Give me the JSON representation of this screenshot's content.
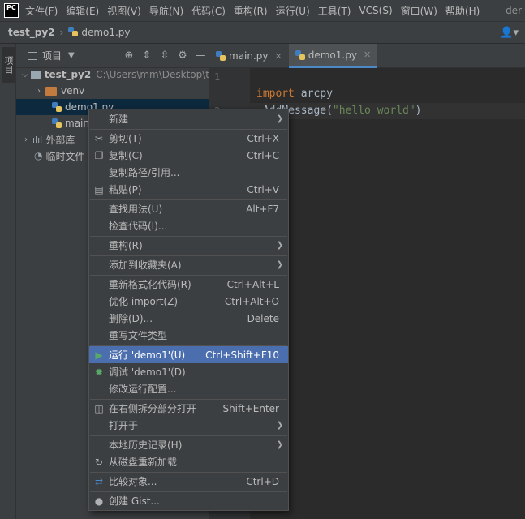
{
  "menubar": {
    "items": [
      "文件(F)",
      "编辑(E)",
      "视图(V)",
      "导航(N)",
      "代码(C)",
      "重构(R)",
      "运行(U)",
      "工具(T)",
      "VCS(S)",
      "窗口(W)",
      "帮助(H)"
    ],
    "overflow_text": "der"
  },
  "navbar": {
    "project": "test_py2",
    "file": "demo1.py"
  },
  "side_tab": {
    "label": "项目"
  },
  "project_panel": {
    "title": "项目",
    "tree": {
      "root_name": "test_py2",
      "root_path": "C:\\Users\\mm\\Desktop\\t",
      "venv": "venv",
      "demo1": "demo1.py",
      "main": "main",
      "external_libs": "外部库",
      "scratches": "临时文件"
    }
  },
  "editor": {
    "tabs": [
      {
        "label": "main.py"
      },
      {
        "label": "demo1.py"
      }
    ],
    "line_numbers": [
      "1",
      "2"
    ],
    "code": {
      "line2_keyword": "import",
      "line2_rest": " arcpy",
      "line3_call": ".AddMessage(",
      "line3_string": "\"hello world\"",
      "line3_end": ")"
    }
  },
  "context_menu": {
    "new": "新建",
    "cut": "剪切(T)",
    "cut_sc": "Ctrl+X",
    "copy": "复制(C)",
    "copy_sc": "Ctrl+C",
    "copy_path": "复制路径/引用...",
    "paste": "粘贴(P)",
    "paste_sc": "Ctrl+V",
    "find_usages": "查找用法(U)",
    "find_usages_sc": "Alt+F7",
    "inspect": "检查代码(I)...",
    "refactor": "重构(R)",
    "add_favorites": "添加到收藏夹(A)",
    "reformat": "重新格式化代码(R)",
    "reformat_sc": "Ctrl+Alt+L",
    "optimize": "优化 import(Z)",
    "optimize_sc": "Ctrl+Alt+O",
    "delete": "删除(D)...",
    "delete_sc": "Delete",
    "override_type": "重写文件类型",
    "run": "运行 'demo1'(U)",
    "run_sc": "Ctrl+Shift+F10",
    "debug": "调试 'demo1'(D)",
    "modify_run": "修改运行配置...",
    "open_split": "在右侧拆分部分打开",
    "open_split_sc": "Shift+Enter",
    "open_in": "打开于",
    "local_history": "本地历史记录(H)",
    "reload": "从磁盘重新加载",
    "compare": "比较对象...",
    "compare_sc": "Ctrl+D",
    "gist": "创建 Gist..."
  }
}
